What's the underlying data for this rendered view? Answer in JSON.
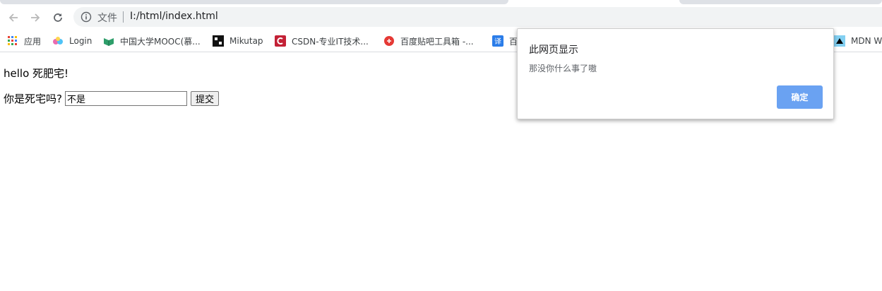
{
  "browser": {
    "address": {
      "scheme_label": "文件",
      "url": "I:/html/index.html"
    },
    "bookmarks": [
      {
        "label": "应用",
        "icon": "apps-grid-icon"
      },
      {
        "label": "Login",
        "icon": "login-icon"
      },
      {
        "label": "中国大学MOOC(慕...",
        "icon": "mooc-icon"
      },
      {
        "label": "Mikutap",
        "icon": "mikutap-icon"
      },
      {
        "label": "CSDN-专业IT技术...",
        "icon": "csdn-icon"
      },
      {
        "label": "百度贴吧工具箱 -...",
        "icon": "baidu-tieba-icon"
      },
      {
        "label": "百",
        "icon": "translate-icon"
      },
      {
        "label": "MDN W",
        "icon": "mdn-icon"
      }
    ]
  },
  "page": {
    "greeting": "hello 死肥宅!",
    "question_label": "你是死宅吗?",
    "answer_value": "不是",
    "submit_label": "提交"
  },
  "dialog": {
    "title": "此网页显示",
    "message": "那没你什么事了嗷",
    "ok_label": "确定"
  },
  "colors": {
    "ok_button": "#6aa2f2",
    "omnibox_bg": "#f1f3f4",
    "csdn_red": "#c32136"
  }
}
